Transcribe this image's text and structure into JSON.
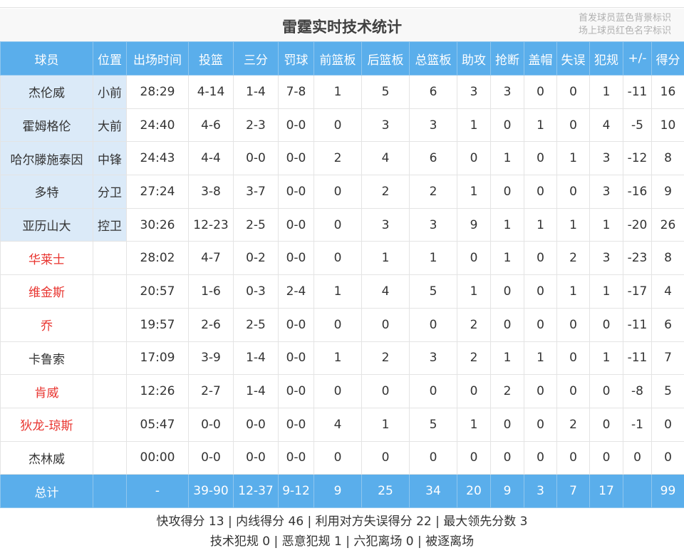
{
  "title": "雷霆实时技术统计",
  "legend": {
    "starter_note": "首发球员蓝色背景标识",
    "oncourt_note": "场上球员红色名字标识"
  },
  "colors": {
    "header_bg": "#5aaeeb",
    "starter_bg": "#dbeaf8",
    "oncourt_text": "#e8332e"
  },
  "columns": [
    "球员",
    "位置",
    "出场时间",
    "投篮",
    "三分",
    "罚球",
    "前篮板",
    "后篮板",
    "总篮板",
    "助攻",
    "抢断",
    "盖帽",
    "失误",
    "犯规",
    "+/-",
    "得分"
  ],
  "players": [
    {
      "name": "杰伦威",
      "pos": "小前",
      "min": "28:29",
      "fg": "4-14",
      "tp": "1-4",
      "ft": "7-8",
      "oreb": "1",
      "dreb": "5",
      "reb": "6",
      "ast": "3",
      "stl": "3",
      "blk": "0",
      "tov": "0",
      "pf": "1",
      "pm": "-11",
      "pts": "16",
      "starter": true,
      "oncourt": false
    },
    {
      "name": "霍姆格伦",
      "pos": "大前",
      "min": "24:40",
      "fg": "4-6",
      "tp": "2-3",
      "ft": "0-0",
      "oreb": "0",
      "dreb": "3",
      "reb": "3",
      "ast": "1",
      "stl": "0",
      "blk": "1",
      "tov": "0",
      "pf": "4",
      "pm": "-5",
      "pts": "10",
      "starter": true,
      "oncourt": false
    },
    {
      "name": "哈尔滕施泰因",
      "pos": "中锋",
      "min": "24:43",
      "fg": "4-4",
      "tp": "0-0",
      "ft": "0-0",
      "oreb": "2",
      "dreb": "4",
      "reb": "6",
      "ast": "0",
      "stl": "1",
      "blk": "0",
      "tov": "1",
      "pf": "3",
      "pm": "-12",
      "pts": "8",
      "starter": true,
      "oncourt": false
    },
    {
      "name": "多特",
      "pos": "分卫",
      "min": "27:24",
      "fg": "3-8",
      "tp": "3-7",
      "ft": "0-0",
      "oreb": "0",
      "dreb": "2",
      "reb": "2",
      "ast": "1",
      "stl": "0",
      "blk": "0",
      "tov": "0",
      "pf": "3",
      "pm": "-16",
      "pts": "9",
      "starter": true,
      "oncourt": false
    },
    {
      "name": "亚历山大",
      "pos": "控卫",
      "min": "30:26",
      "fg": "12-23",
      "tp": "2-5",
      "ft": "0-0",
      "oreb": "0",
      "dreb": "3",
      "reb": "3",
      "ast": "9",
      "stl": "1",
      "blk": "1",
      "tov": "1",
      "pf": "1",
      "pm": "-20",
      "pts": "26",
      "starter": true,
      "oncourt": false
    },
    {
      "name": "华莱士",
      "pos": "",
      "min": "28:02",
      "fg": "4-7",
      "tp": "0-2",
      "ft": "0-0",
      "oreb": "0",
      "dreb": "1",
      "reb": "1",
      "ast": "0",
      "stl": "1",
      "blk": "0",
      "tov": "2",
      "pf": "3",
      "pm": "-23",
      "pts": "8",
      "starter": false,
      "oncourt": true
    },
    {
      "name": "维金斯",
      "pos": "",
      "min": "20:57",
      "fg": "1-6",
      "tp": "0-3",
      "ft": "2-4",
      "oreb": "1",
      "dreb": "4",
      "reb": "5",
      "ast": "1",
      "stl": "0",
      "blk": "0",
      "tov": "1",
      "pf": "1",
      "pm": "-17",
      "pts": "4",
      "starter": false,
      "oncourt": true
    },
    {
      "name": "乔",
      "pos": "",
      "min": "19:57",
      "fg": "2-6",
      "tp": "2-5",
      "ft": "0-0",
      "oreb": "0",
      "dreb": "0",
      "reb": "0",
      "ast": "2",
      "stl": "0",
      "blk": "0",
      "tov": "0",
      "pf": "0",
      "pm": "-11",
      "pts": "6",
      "starter": false,
      "oncourt": true
    },
    {
      "name": "卡鲁索",
      "pos": "",
      "min": "17:09",
      "fg": "3-9",
      "tp": "1-4",
      "ft": "0-0",
      "oreb": "1",
      "dreb": "2",
      "reb": "3",
      "ast": "2",
      "stl": "1",
      "blk": "1",
      "tov": "0",
      "pf": "1",
      "pm": "-11",
      "pts": "7",
      "starter": false,
      "oncourt": false
    },
    {
      "name": "肯威",
      "pos": "",
      "min": "12:26",
      "fg": "2-7",
      "tp": "1-4",
      "ft": "0-0",
      "oreb": "0",
      "dreb": "0",
      "reb": "0",
      "ast": "0",
      "stl": "2",
      "blk": "0",
      "tov": "0",
      "pf": "0",
      "pm": "-8",
      "pts": "5",
      "starter": false,
      "oncourt": true
    },
    {
      "name": "狄龙-琼斯",
      "pos": "",
      "min": "05:47",
      "fg": "0-0",
      "tp": "0-0",
      "ft": "0-0",
      "oreb": "4",
      "dreb": "1",
      "reb": "5",
      "ast": "1",
      "stl": "0",
      "blk": "0",
      "tov": "2",
      "pf": "0",
      "pm": "-1",
      "pts": "0",
      "starter": false,
      "oncourt": true
    },
    {
      "name": "杰林威",
      "pos": "",
      "min": "00:00",
      "fg": "0-0",
      "tp": "0-0",
      "ft": "0-0",
      "oreb": "0",
      "dreb": "0",
      "reb": "0",
      "ast": "0",
      "stl": "0",
      "blk": "0",
      "tov": "0",
      "pf": "0",
      "pm": "0",
      "pts": "0",
      "starter": false,
      "oncourt": false
    }
  ],
  "totals": {
    "name": "总计",
    "pos": "",
    "min": "-",
    "fg": "39-90",
    "tp": "12-37",
    "ft": "9-12",
    "oreb": "9",
    "dreb": "25",
    "reb": "34",
    "ast": "20",
    "stl": "9",
    "blk": "3",
    "tov": "7",
    "pf": "17",
    "pm": "",
    "pts": "99"
  },
  "footer": {
    "line1": "快攻得分 13 | 内线得分 46 | 利用对方失误得分 22 | 最大领先分数 3",
    "line2": "技术犯规 0 | 恶意犯规 1 | 六犯离场 0 | 被逐离场"
  }
}
